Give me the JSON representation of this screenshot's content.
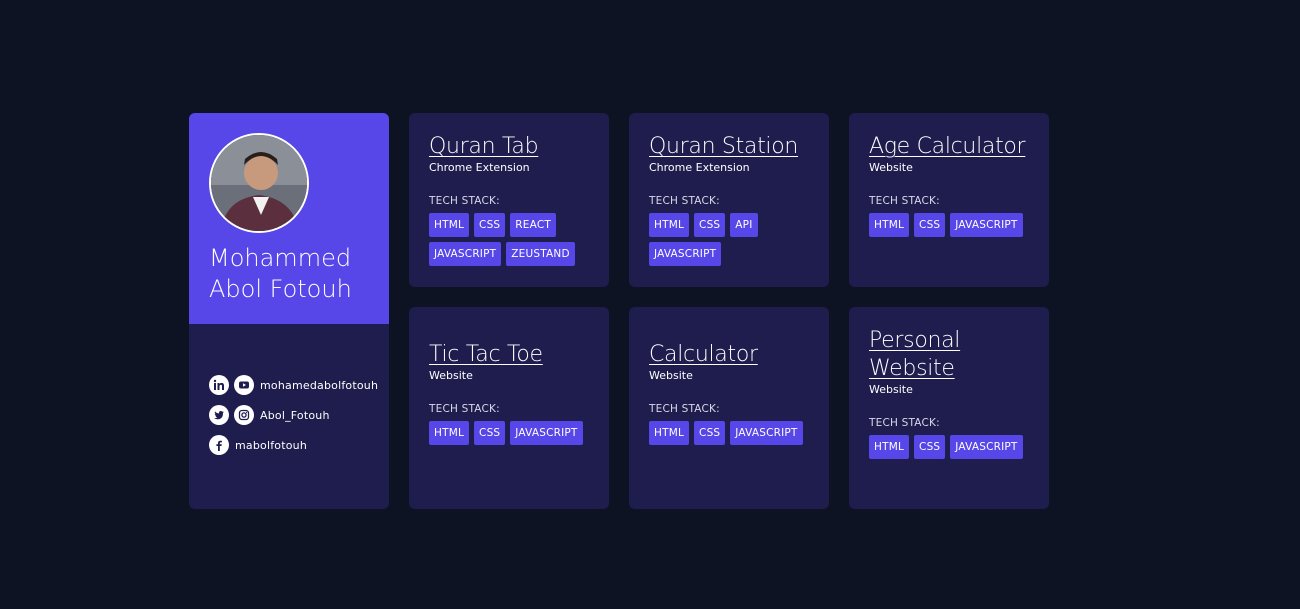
{
  "profile": {
    "name": "Mohammed Abol Fotouh",
    "socials": [
      {
        "icons": [
          "linkedin-icon",
          "youtube-icon"
        ],
        "handle": "mohamedabolfotouh"
      },
      {
        "icons": [
          "twitter-icon",
          "instagram-icon"
        ],
        "handle": "Abol_Fotouh"
      },
      {
        "icons": [
          "facebook-icon"
        ],
        "handle": "mabolfotouh"
      }
    ]
  },
  "tech_label": "TECH STACK:",
  "projects": [
    {
      "title": "Quran Tab",
      "type": "Chrome Extension",
      "tags": [
        "HTML",
        "CSS",
        "REACT",
        "JAVASCRIPT",
        "ZEUSTAND"
      ]
    },
    {
      "title": "Quran Station",
      "type": "Chrome Extension",
      "tags": [
        "HTML",
        "CSS",
        "API",
        "JAVASCRIPT"
      ]
    },
    {
      "title": "Age Calculator",
      "type": "Website",
      "tags": [
        "HTML",
        "CSS",
        "JAVASCRIPT"
      ]
    },
    {
      "title": "Tic Tac Toe",
      "type": "Website",
      "tags": [
        "HTML",
        "CSS",
        "JAVASCRIPT"
      ]
    },
    {
      "title": "Calculator",
      "type": "Website",
      "tags": [
        "HTML",
        "CSS",
        "JAVASCRIPT"
      ]
    },
    {
      "title": "Personal Website",
      "type": "Website",
      "tags": [
        "HTML",
        "CSS",
        "JAVASCRIPT"
      ]
    }
  ],
  "colors": {
    "background": "#0e1323",
    "card": "#1e1d4d",
    "accent": "#5746e8"
  }
}
